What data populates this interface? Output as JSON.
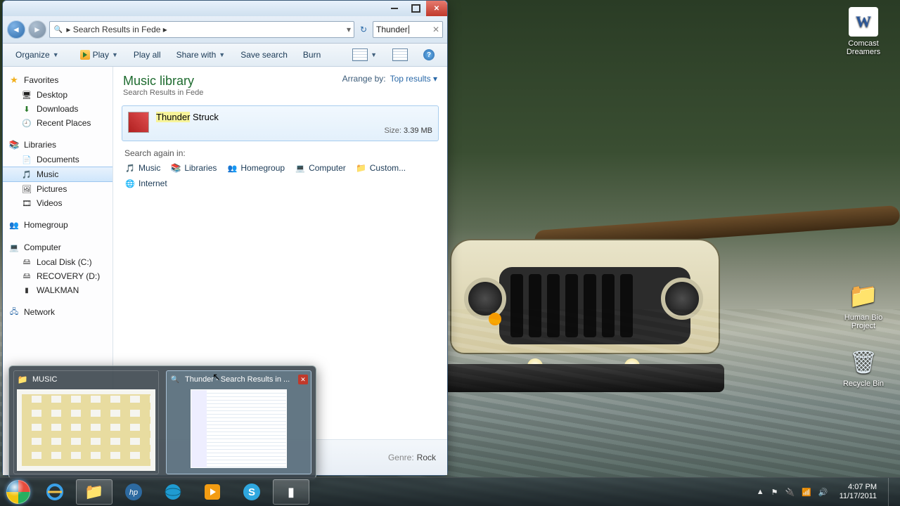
{
  "desktop": {
    "icons": {
      "word": "Comcast Dreamers",
      "hbio": "Human Bio Project",
      "bin": "Recycle Bin"
    }
  },
  "explorer": {
    "address": "Search Results in Fede",
    "search_value": "Thunder",
    "toolbar": {
      "organize": "Organize",
      "play": "Play",
      "play_all": "Play all",
      "share": "Share with",
      "save_search": "Save search",
      "burn": "Burn"
    },
    "nav": {
      "favorites": "Favorites",
      "fav_items": [
        "Desktop",
        "Downloads",
        "Recent Places"
      ],
      "libraries": "Libraries",
      "lib_items": [
        "Documents",
        "Music",
        "Pictures",
        "Videos"
      ],
      "homegroup": "Homegroup",
      "computer": "Computer",
      "drives": [
        "Local Disk (C:)",
        "RECOVERY (D:)",
        "WALKMAN"
      ],
      "network": "Network"
    },
    "library": {
      "title": "Music library",
      "subtitle": "Search Results in Fede",
      "arrange_label": "Arrange by:",
      "arrange_value": "Top results"
    },
    "result": {
      "highlight": "Thunder",
      "rest": " Struck",
      "size_label": "Size:",
      "size_value": "3.39 MB"
    },
    "search_again": {
      "label": "Search again in:",
      "targets": [
        "Music",
        "Libraries",
        "Homegroup",
        "Computer",
        "Custom...",
        "Internet"
      ]
    },
    "details": {
      "genre_label": "Genre:",
      "genre_value": "Rock"
    }
  },
  "thumbnails": {
    "w1": "MUSIC",
    "w2": "Thunder - Search Results in ..."
  },
  "taskbar": {
    "time": "4:07 PM",
    "date": "11/17/2011"
  }
}
